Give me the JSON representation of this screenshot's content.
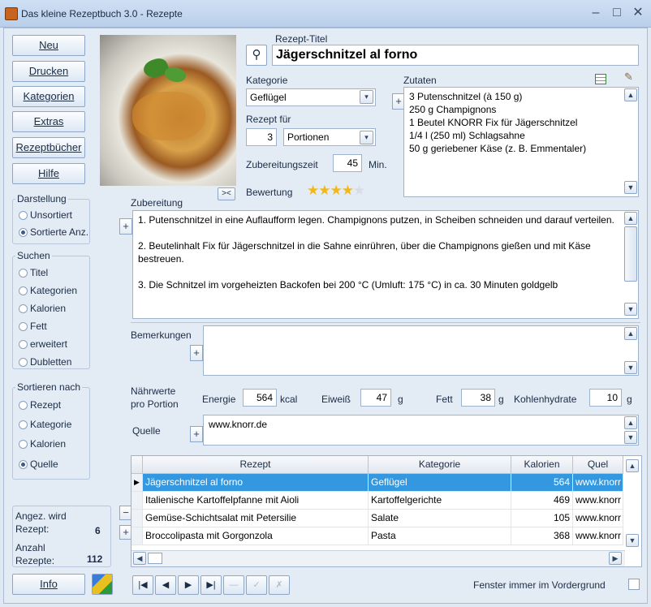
{
  "window": {
    "title": "Das kleine Rezeptbuch 3.0 - Rezepte"
  },
  "sidebar": {
    "buttons": [
      "Neu",
      "Drucken",
      "Kategorien",
      "Extras",
      "Rezeptbücher",
      "Hilfe"
    ],
    "darstellung": {
      "title": "Darstellung",
      "options": [
        "Unsortiert",
        "Sortierte Anz."
      ],
      "selected": "Sortierte Anz."
    },
    "suchen": {
      "title": "Suchen",
      "options": [
        "Titel",
        "Kategorien",
        "Kalorien",
        "Fett",
        "erweitert",
        "Dubletten"
      ]
    },
    "sortieren": {
      "title": "Sortieren nach",
      "options": [
        "Rezept",
        "Kategorie",
        "Kalorien",
        "Quelle"
      ],
      "selected": "Quelle"
    },
    "stats": {
      "angez_label_1": "Angez. wird",
      "angez_label_2": "Rezept:",
      "angez_value": "6",
      "anzahl_label_1": "Anzahl",
      "anzahl_label_2": "Rezepte:",
      "anzahl_value": "112"
    },
    "info_button": "Info"
  },
  "recipe": {
    "title_label": "Rezept-Titel",
    "title": "Jägerschnitzel al forno",
    "kategorie_label": "Kategorie",
    "kategorie": "Geflügel",
    "rezept_fuer_label": "Rezept für",
    "portionen_anzahl": "3",
    "portionen_einheit": "Portionen",
    "zubereitungszeit_label": "Zubereitungszeit",
    "zubereitungszeit": "45",
    "zeit_einheit": "Min.",
    "bewertung_label": "Bewertung",
    "bewertung": 4,
    "bewertung_max": 5,
    "zutaten_label": "Zutaten",
    "zutaten": [
      "3 Putenschnitzel (à 150 g)",
      "250 g Champignons",
      "1 Beutel KNORR Fix für Jägerschnitzel",
      "1/4 l (250 ml) Schlagsahne",
      "50 g geriebener Käse (z. B. Emmentaler)"
    ],
    "zubereitung_label": "Zubereitung",
    "zubereitung": [
      "1. Putenschnitzel in eine Auflaufform legen. Champignons putzen, in Scheiben schneiden und darauf verteilen.",
      "2. Beutelinhalt Fix für Jägerschnitzel in die Sahne einrühren, über die Champignons gießen und mit Käse bestreuen.",
      "3. Die Schnitzel im vorgeheizten Backofen bei 200 °C (Umluft: 175 °C) in ca. 30 Minuten goldgelb"
    ],
    "bemerkungen_label": "Bemerkungen",
    "naehrwerte_label_1": "Nährwerte",
    "naehrwerte_label_2": "pro Portion",
    "energie_label": "Energie",
    "energie": "564",
    "energie_unit": "kcal",
    "eiweiss_label": "Eiweiß",
    "eiweiss": "47",
    "eiweiss_unit": "g",
    "fett_label": "Fett",
    "fett": "38",
    "fett_unit": "g",
    "kh_label": "Kohlenhydrate",
    "kh": "10",
    "kh_unit": "g",
    "quelle_label": "Quelle",
    "quelle": "www.knorr.de"
  },
  "table": {
    "columns": [
      "Rezept",
      "Kategorie",
      "Kalorien",
      "Quel"
    ],
    "rows": [
      [
        "Jägerschnitzel al forno",
        "Geflügel",
        "564",
        "www.knorr"
      ],
      [
        "Italienische Kartoffelpfanne mit Aioli",
        "Kartoffelgerichte",
        "469",
        "www.knorr"
      ],
      [
        "Gemüse-Schichtsalat mit Petersilie",
        "Salate",
        "105",
        "www.knorr"
      ],
      [
        "Broccolipasta mit Gorgonzola",
        "Pasta",
        "368",
        "www.knorr"
      ]
    ],
    "selected_row": 0
  },
  "footer": {
    "always_on_top_label": "Fenster immer im Vordergrund"
  }
}
